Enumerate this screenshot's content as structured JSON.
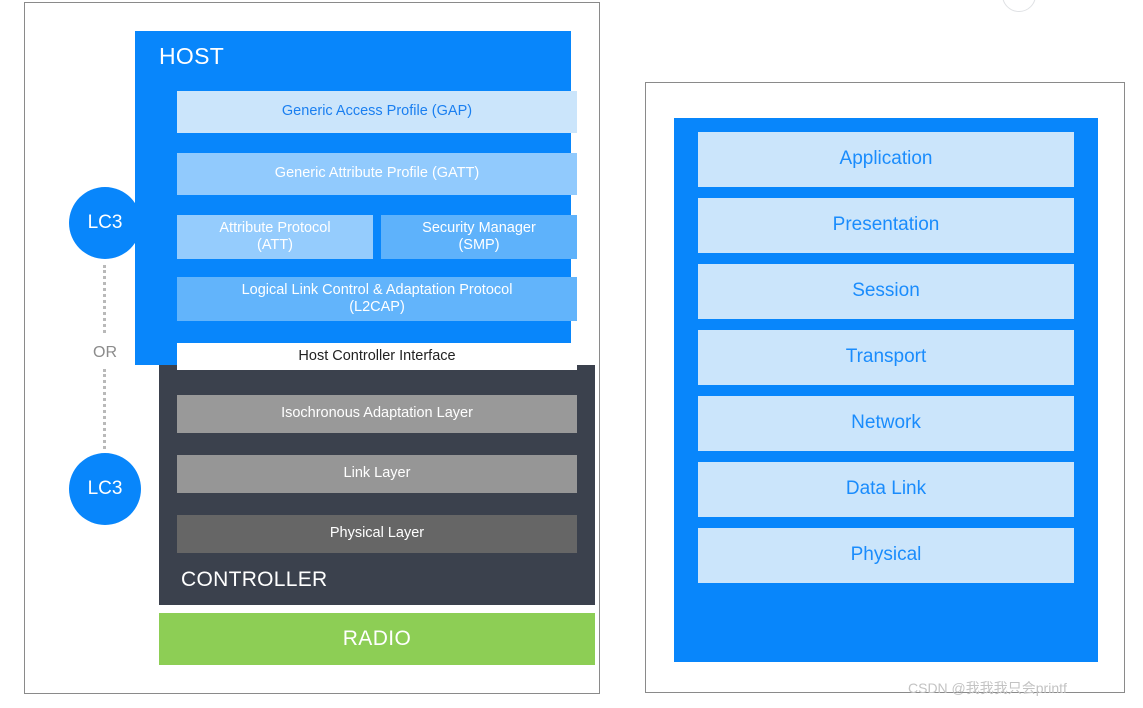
{
  "diagram": {
    "left_panel": {
      "host": {
        "title": "HOST",
        "rows": [
          {
            "label": "Generic Access Profile (GAP)"
          },
          {
            "label": "Generic Attribute Profile (GATT)"
          },
          {
            "label": "Attribute Protocol\n(ATT)",
            "line1": "Attribute Protocol",
            "line2": "(ATT)"
          },
          {
            "label": "Security Manager\n(SMP)",
            "line1": "Security Manager",
            "line2": "(SMP)"
          },
          {
            "label": "Logical Link Control & Adaptation Protocol\n(L2CAP)",
            "line1": "Logical Link Control & Adaptation Protocol",
            "line2": "(L2CAP)"
          }
        ]
      },
      "hci": {
        "label": "Host Controller Interface"
      },
      "controller": {
        "title": "CONTROLLER",
        "rows": [
          {
            "label": "Isochronous Adaptation Layer"
          },
          {
            "label": "Link Layer"
          },
          {
            "label": "Physical Layer"
          }
        ]
      },
      "radio": {
        "label": "RADIO"
      },
      "codec": {
        "top_label": "LC3",
        "bottom_label": "LC3",
        "separator_label": "OR"
      }
    },
    "right_panel": {
      "layers": [
        {
          "label": "Application"
        },
        {
          "label": "Presentation"
        },
        {
          "label": "Session"
        },
        {
          "label": "Transport"
        },
        {
          "label": "Network"
        },
        {
          "label": "Data Link"
        },
        {
          "label": "Physical"
        }
      ]
    },
    "watermark": {
      "text": "CSDN @我我我只会printf"
    },
    "colors": {
      "brand_blue": "#0886fb",
      "light_blue": "#cbe5fb",
      "mid_blue": "#91cafd",
      "att_blue": "#95ccfd",
      "smp_blue": "#5eb2fb",
      "l2cap_blue": "#62b4fb",
      "osi_text_blue": "#1a8cfc",
      "controller_dark": "#3b414d",
      "gray_light": "#999999",
      "gray_mid": "#969696",
      "gray_dark": "#666666",
      "radio_green": "#8dce55",
      "panel_border": "#8a8a8a",
      "dotted_gray": "#b9b9b9",
      "or_gray": "#8b8b8b",
      "watermark_gray": "#c3c3c3"
    }
  }
}
